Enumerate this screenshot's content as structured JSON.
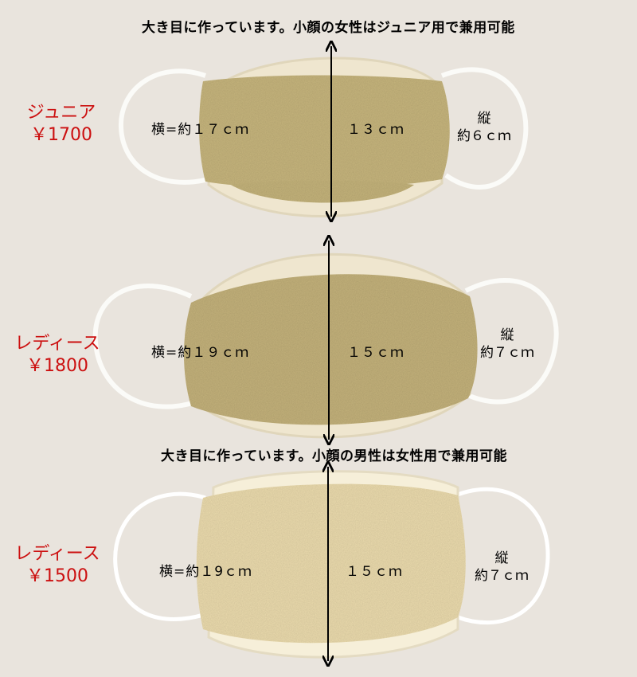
{
  "headings": {
    "top": "大き目に作っています。小顔の女性はジュニア用で兼用可能",
    "middle": "大き目に作っています。小顔の男性は女性用で兼用可能"
  },
  "masks": [
    {
      "name": "ジュニア",
      "price": "￥1700",
      "width_text": "横=約１７ｃｍ",
      "height_text": "１３ｃｍ",
      "depth_label": "縦",
      "depth_value": "約６ｃｍ",
      "fabric_color": "#c7b67e"
    },
    {
      "name": "レディース",
      "price": "￥1800",
      "width_text": "横=約１９ｃｍ",
      "height_text": "１５ｃｍ",
      "depth_label": "縦",
      "depth_value": "約７ｃｍ",
      "fabric_color": "#c4b27c"
    },
    {
      "name": "レディース",
      "price": "￥1500",
      "width_text": "横=約１9ｃｍ",
      "height_text": "１５ｃｍ",
      "depth_label": "縦",
      "depth_value": "約７ｃｍ",
      "fabric_color": "#ecdcae"
    }
  ]
}
